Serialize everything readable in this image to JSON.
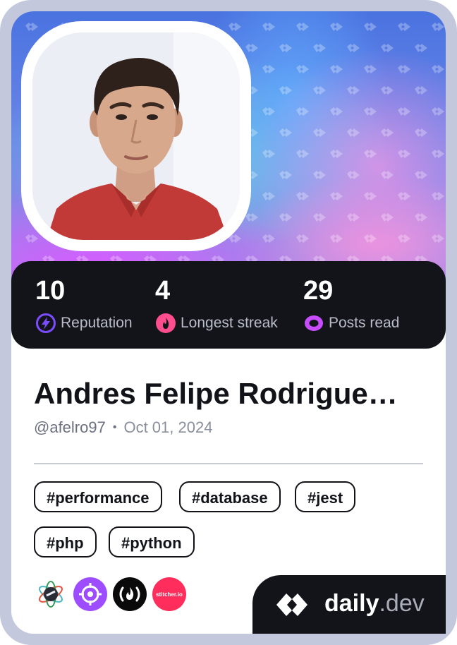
{
  "profile": {
    "name": "Andres Felipe Rodrigue…",
    "handle": "@afelro97",
    "separator": "•",
    "date": "Oct 01, 2024"
  },
  "stats": [
    {
      "value": "10",
      "label": "Reputation",
      "icon": "lightning-icon",
      "color": "#7b4dff"
    },
    {
      "value": "4",
      "label": "Longest streak",
      "icon": "flame-icon",
      "color": "#ff4d8d"
    },
    {
      "value": "29",
      "label": "Posts read",
      "icon": "eye-icon",
      "color": "#c74dff"
    }
  ],
  "tags": [
    "#performance",
    "#database",
    "#jest",
    "#php",
    "#python"
  ],
  "sources": [
    {
      "name": "atom-source-icon"
    },
    {
      "name": "target-source-icon",
      "color": "#9d4dff"
    },
    {
      "name": "fcc-source-icon",
      "color": "#0a0a0a"
    },
    {
      "name": "stitcher-source-icon",
      "color": "#ff2d5c",
      "label": "stitcher.io"
    }
  ],
  "brand": {
    "name": "daily",
    "tld": ".dev"
  },
  "colors": {
    "card": "#ffffff",
    "dark": "#121419",
    "frame": "#c3c8dd"
  }
}
